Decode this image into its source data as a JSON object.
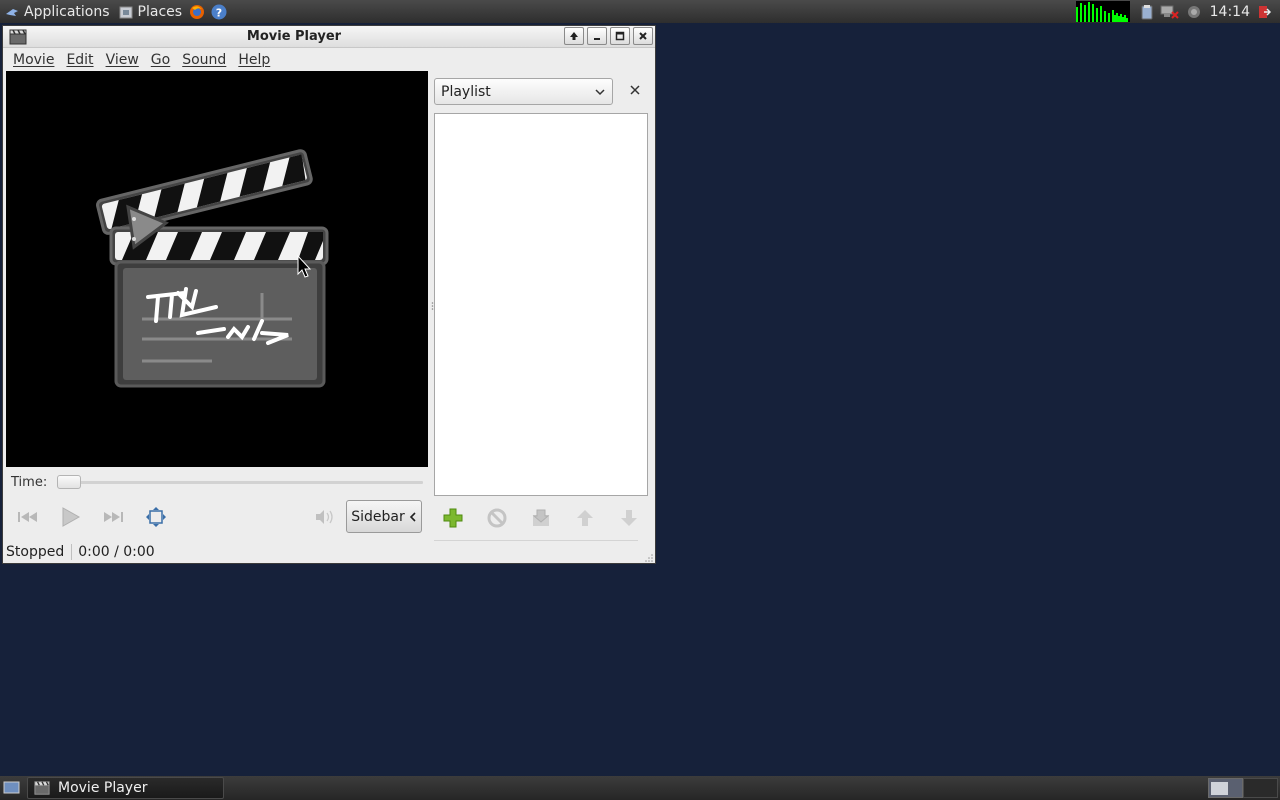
{
  "top_panel": {
    "applications_label": "Applications",
    "places_label": "Places",
    "clock": "14:14"
  },
  "window": {
    "title": "Movie Player",
    "menu": [
      "Movie",
      "Edit",
      "View",
      "Go",
      "Sound",
      "Help"
    ]
  },
  "player": {
    "time_label": "Time:",
    "seek_position": 0,
    "sidebar_button_label": "Sidebar"
  },
  "sidebar": {
    "selected_panel": "Playlist",
    "playlist_items": []
  },
  "status": {
    "state": "Stopped",
    "time": "0:00 / 0:00"
  },
  "taskbar": {
    "tasks": [
      {
        "label": "Movie Player",
        "active": true
      }
    ]
  },
  "colors": {
    "desktop": "#16213a",
    "add_icon": "#7cb82f",
    "cpu_graph": "#00ff00"
  }
}
